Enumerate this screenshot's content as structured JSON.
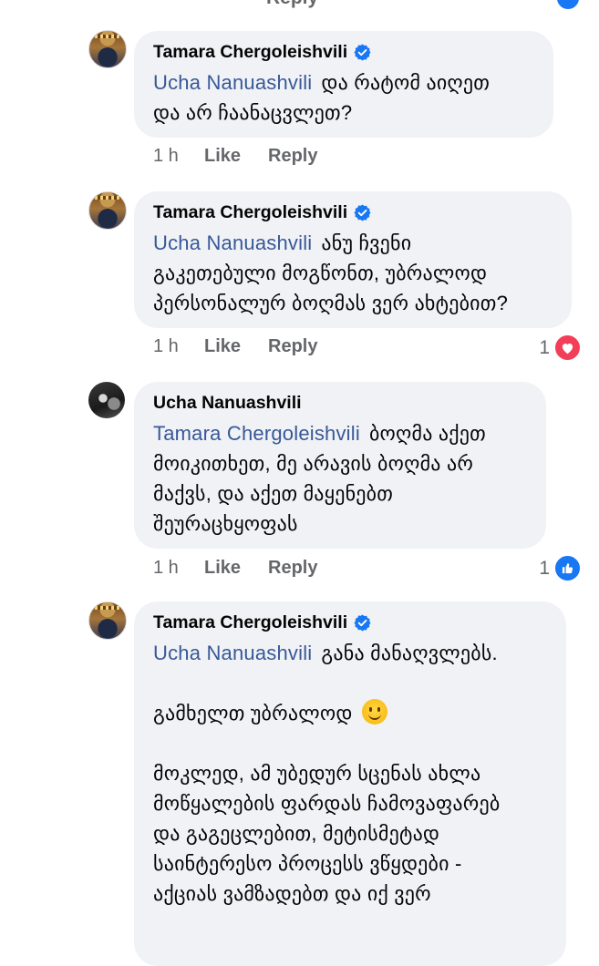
{
  "top_fragment": {
    "reply_label": "Reply"
  },
  "comments": [
    {
      "author": "Tamara Chergoleishvili",
      "verified": true,
      "mention": "Ucha Nanuashvili",
      "lines": [
        "და რატომ აიღეთ",
        "და არ ჩაანაცვლეთ?"
      ],
      "time": "1 h",
      "like_label": "Like",
      "reply_label": "Reply"
    },
    {
      "author": "Tamara Chergoleishvili",
      "verified": true,
      "mention": "Ucha Nanuashvili",
      "lines": [
        "ანუ ჩვენი",
        "გაკეთებული მოგწონთ, უბრალოდ",
        "პერსონალურ ბოღმას ვერ ახტებით?"
      ],
      "time": "1 h",
      "like_label": "Like",
      "reply_label": "Reply",
      "reaction": {
        "count": "1",
        "type": "love-icon"
      }
    },
    {
      "author": "Ucha Nanuashvili",
      "verified": false,
      "mention": "Tamara Chergoleishvili",
      "lines": [
        "ბოღმა აქეთ",
        "მოიკითხეთ, მე არავის ბოღმა არ",
        "მაქვს, და აქეთ მაყენებთ",
        "შეურაცხყოფას"
      ],
      "time": "1 h",
      "like_label": "Like",
      "reply_label": "Reply",
      "reaction": {
        "count": "1",
        "type": "like-icon"
      }
    },
    {
      "author": "Tamara Chergoleishvili",
      "verified": true,
      "mention": "Ucha Nanuashvili",
      "first_line": "განა მანაღვლებს.",
      "second_para": "გამხელთ უბრალოდ",
      "third_para": [
        "მოკლედ, ამ უბედურ სცენას ახლა",
        "მოწყალების ფარდას ჩამოვაფარებ",
        "და გაგეცლებით, მეტისმეტად",
        "საინტერესო პროცესს ვწყდები -",
        "აქციას ვამზადებთ და იქ ვერ"
      ]
    }
  ],
  "colors": {
    "bubble_bg": "#f0f2f5",
    "mention": "#385898",
    "meta": "#65676b",
    "verified": "#1877f2",
    "love": "#f33e58",
    "like": "#1877f2"
  }
}
